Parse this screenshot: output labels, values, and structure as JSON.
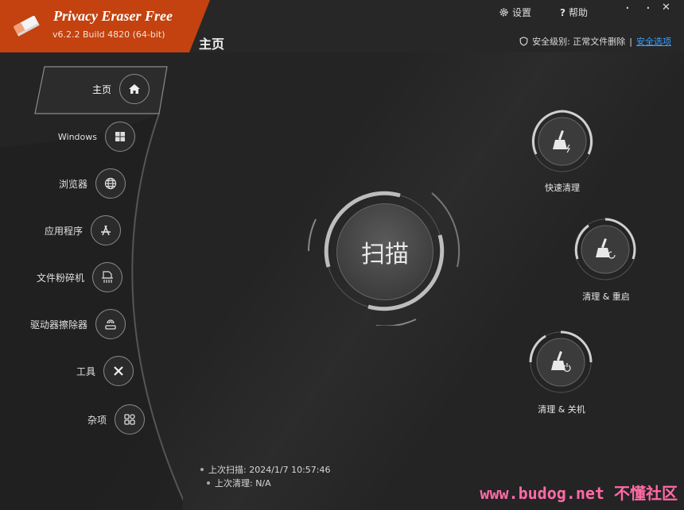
{
  "app": {
    "title": "Privacy Eraser Free",
    "version": "v6.2.2 Build 4820 (64-bit)"
  },
  "header": {
    "settings_label": "设置",
    "help_label": "帮助",
    "minimize_symbol": "·",
    "close_symbol": "✕",
    "page_title": "主页",
    "security_label": "安全级别: 正常文件删除",
    "security_separator": "|",
    "security_link": "安全选项"
  },
  "sidebar": {
    "items": [
      {
        "label": "主页",
        "icon": "home-icon"
      },
      {
        "label": "Windows",
        "icon": "windows-icon"
      },
      {
        "label": "浏览器",
        "icon": "globe-icon"
      },
      {
        "label": "应用程序",
        "icon": "apps-icon"
      },
      {
        "label": "文件粉碎机",
        "icon": "shredder-icon"
      },
      {
        "label": "驱动器擦除器",
        "icon": "drive-wipe-icon"
      },
      {
        "label": "工具",
        "icon": "tools-icon"
      },
      {
        "label": "杂项",
        "icon": "misc-icon"
      }
    ]
  },
  "main": {
    "scan_label": "扫描",
    "actions": [
      {
        "label": "快速清理",
        "icon": "broom-bolt-icon"
      },
      {
        "label": "清理 & 重启",
        "icon": "broom-restart-icon"
      },
      {
        "label": "清理 & 关机",
        "icon": "broom-power-icon"
      }
    ],
    "last_scan": "上次扫描: 2024/1/7 10:57:46",
    "last_clean": "上次清理: N/A"
  },
  "watermark": "www.budog.net 不懂社区",
  "colors": {
    "brand": "#c3420f",
    "background": "#242424",
    "link": "#3aa0ff",
    "watermark": "#ff6aa6"
  }
}
